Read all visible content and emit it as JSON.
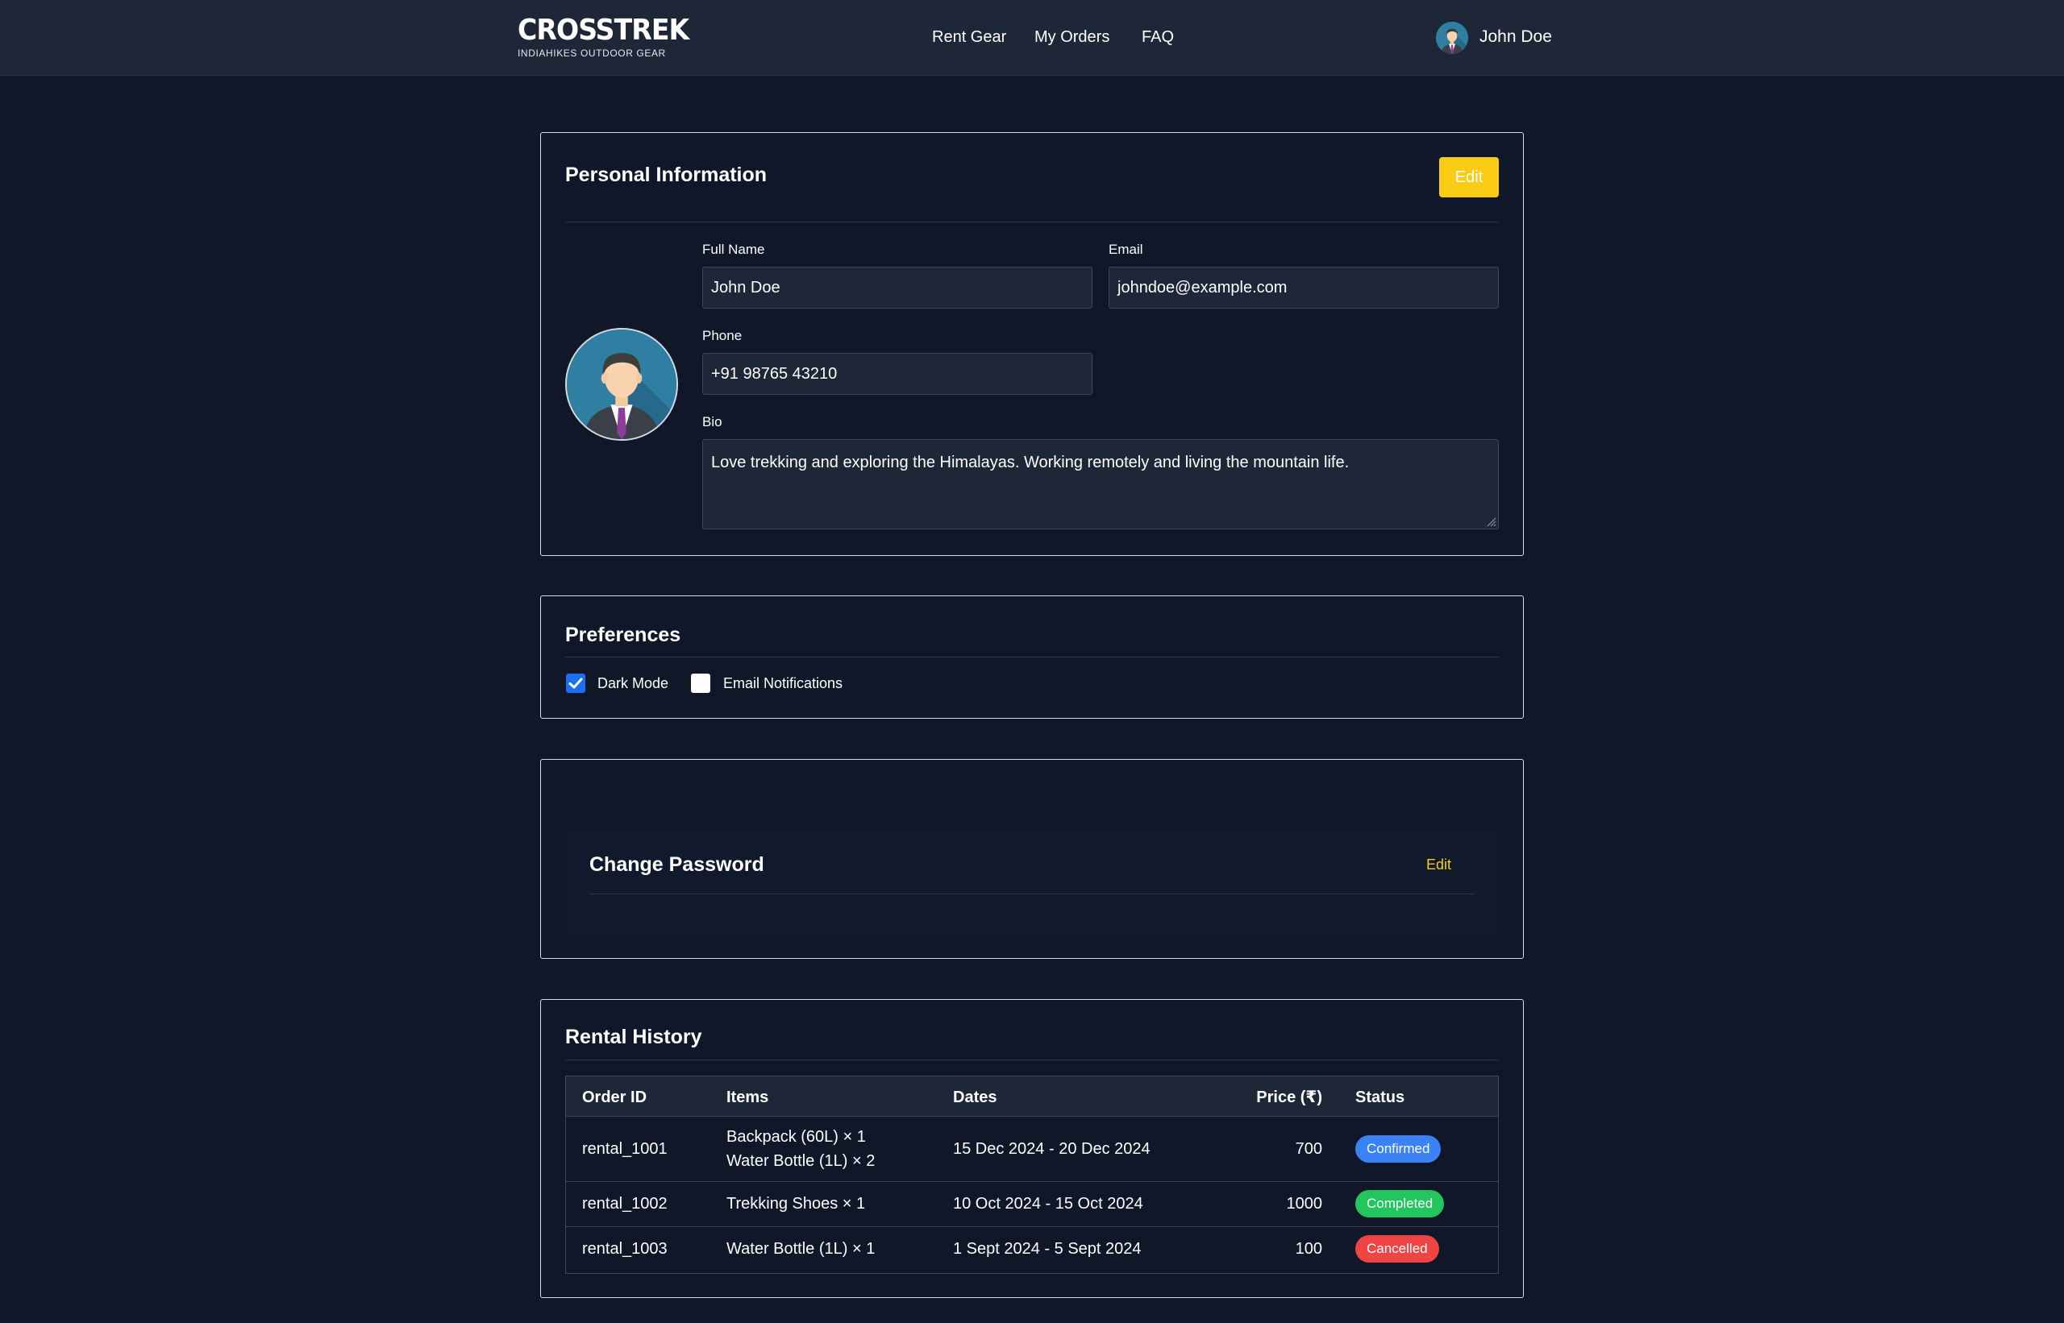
{
  "header": {
    "logo_title": "CROSSTREK",
    "logo_subtitle": "INDIAHIKES OUTDOOR GEAR",
    "nav": [
      "Rent Gear",
      "My Orders",
      "FAQ"
    ],
    "user_name": "John Doe"
  },
  "personal_info": {
    "title": "Personal Information",
    "edit_label": "Edit",
    "full_name_label": "Full Name",
    "full_name": "John Doe",
    "email_label": "Email",
    "email": "johndoe@example.com",
    "phone_label": "Phone",
    "phone": "+91 98765 43210",
    "bio_label": "Bio",
    "bio": "Love trekking and exploring the Himalayas. Working remotely and living the mountain life."
  },
  "preferences": {
    "title": "Preferences",
    "dark_mode_label": "Dark Mode",
    "dark_mode": true,
    "email_notifications_label": "Email Notifications",
    "email_notifications": false
  },
  "change_password": {
    "title": "Change Password",
    "edit_label": "Edit"
  },
  "rental_history": {
    "title": "Rental History",
    "columns": [
      "Order ID",
      "Items",
      "Dates",
      "Price (₹)",
      "Status"
    ],
    "rows": [
      {
        "order_id": "rental_1001",
        "items": [
          "Backpack (60L) × 1",
          "Water Bottle (1L) × 2"
        ],
        "dates": "15 Dec 2024 - 20 Dec 2024",
        "price": "700",
        "status": "Confirmed"
      },
      {
        "order_id": "rental_1002",
        "items": [
          "Trekking Shoes × 1"
        ],
        "dates": "10 Oct 2024 - 15 Oct 2024",
        "price": "1000",
        "status": "Completed"
      },
      {
        "order_id": "rental_1003",
        "items": [
          "Water Bottle (1L) × 1"
        ],
        "dates": "1 Sept 2024 - 5 Sept 2024",
        "price": "100",
        "status": "Cancelled"
      }
    ]
  },
  "colors": {
    "page_bg": "#0f1729",
    "header_bg": "#1e2737",
    "accent": "#fbcc15",
    "checkbox_on": "#1c6ef2",
    "status_confirmed": "#3b82f6",
    "status_completed": "#22c55e",
    "status_cancelled": "#ef4444"
  },
  "icons": [
    "user-avatar-icon",
    "checkmark-icon",
    "resize-grip-icon"
  ]
}
